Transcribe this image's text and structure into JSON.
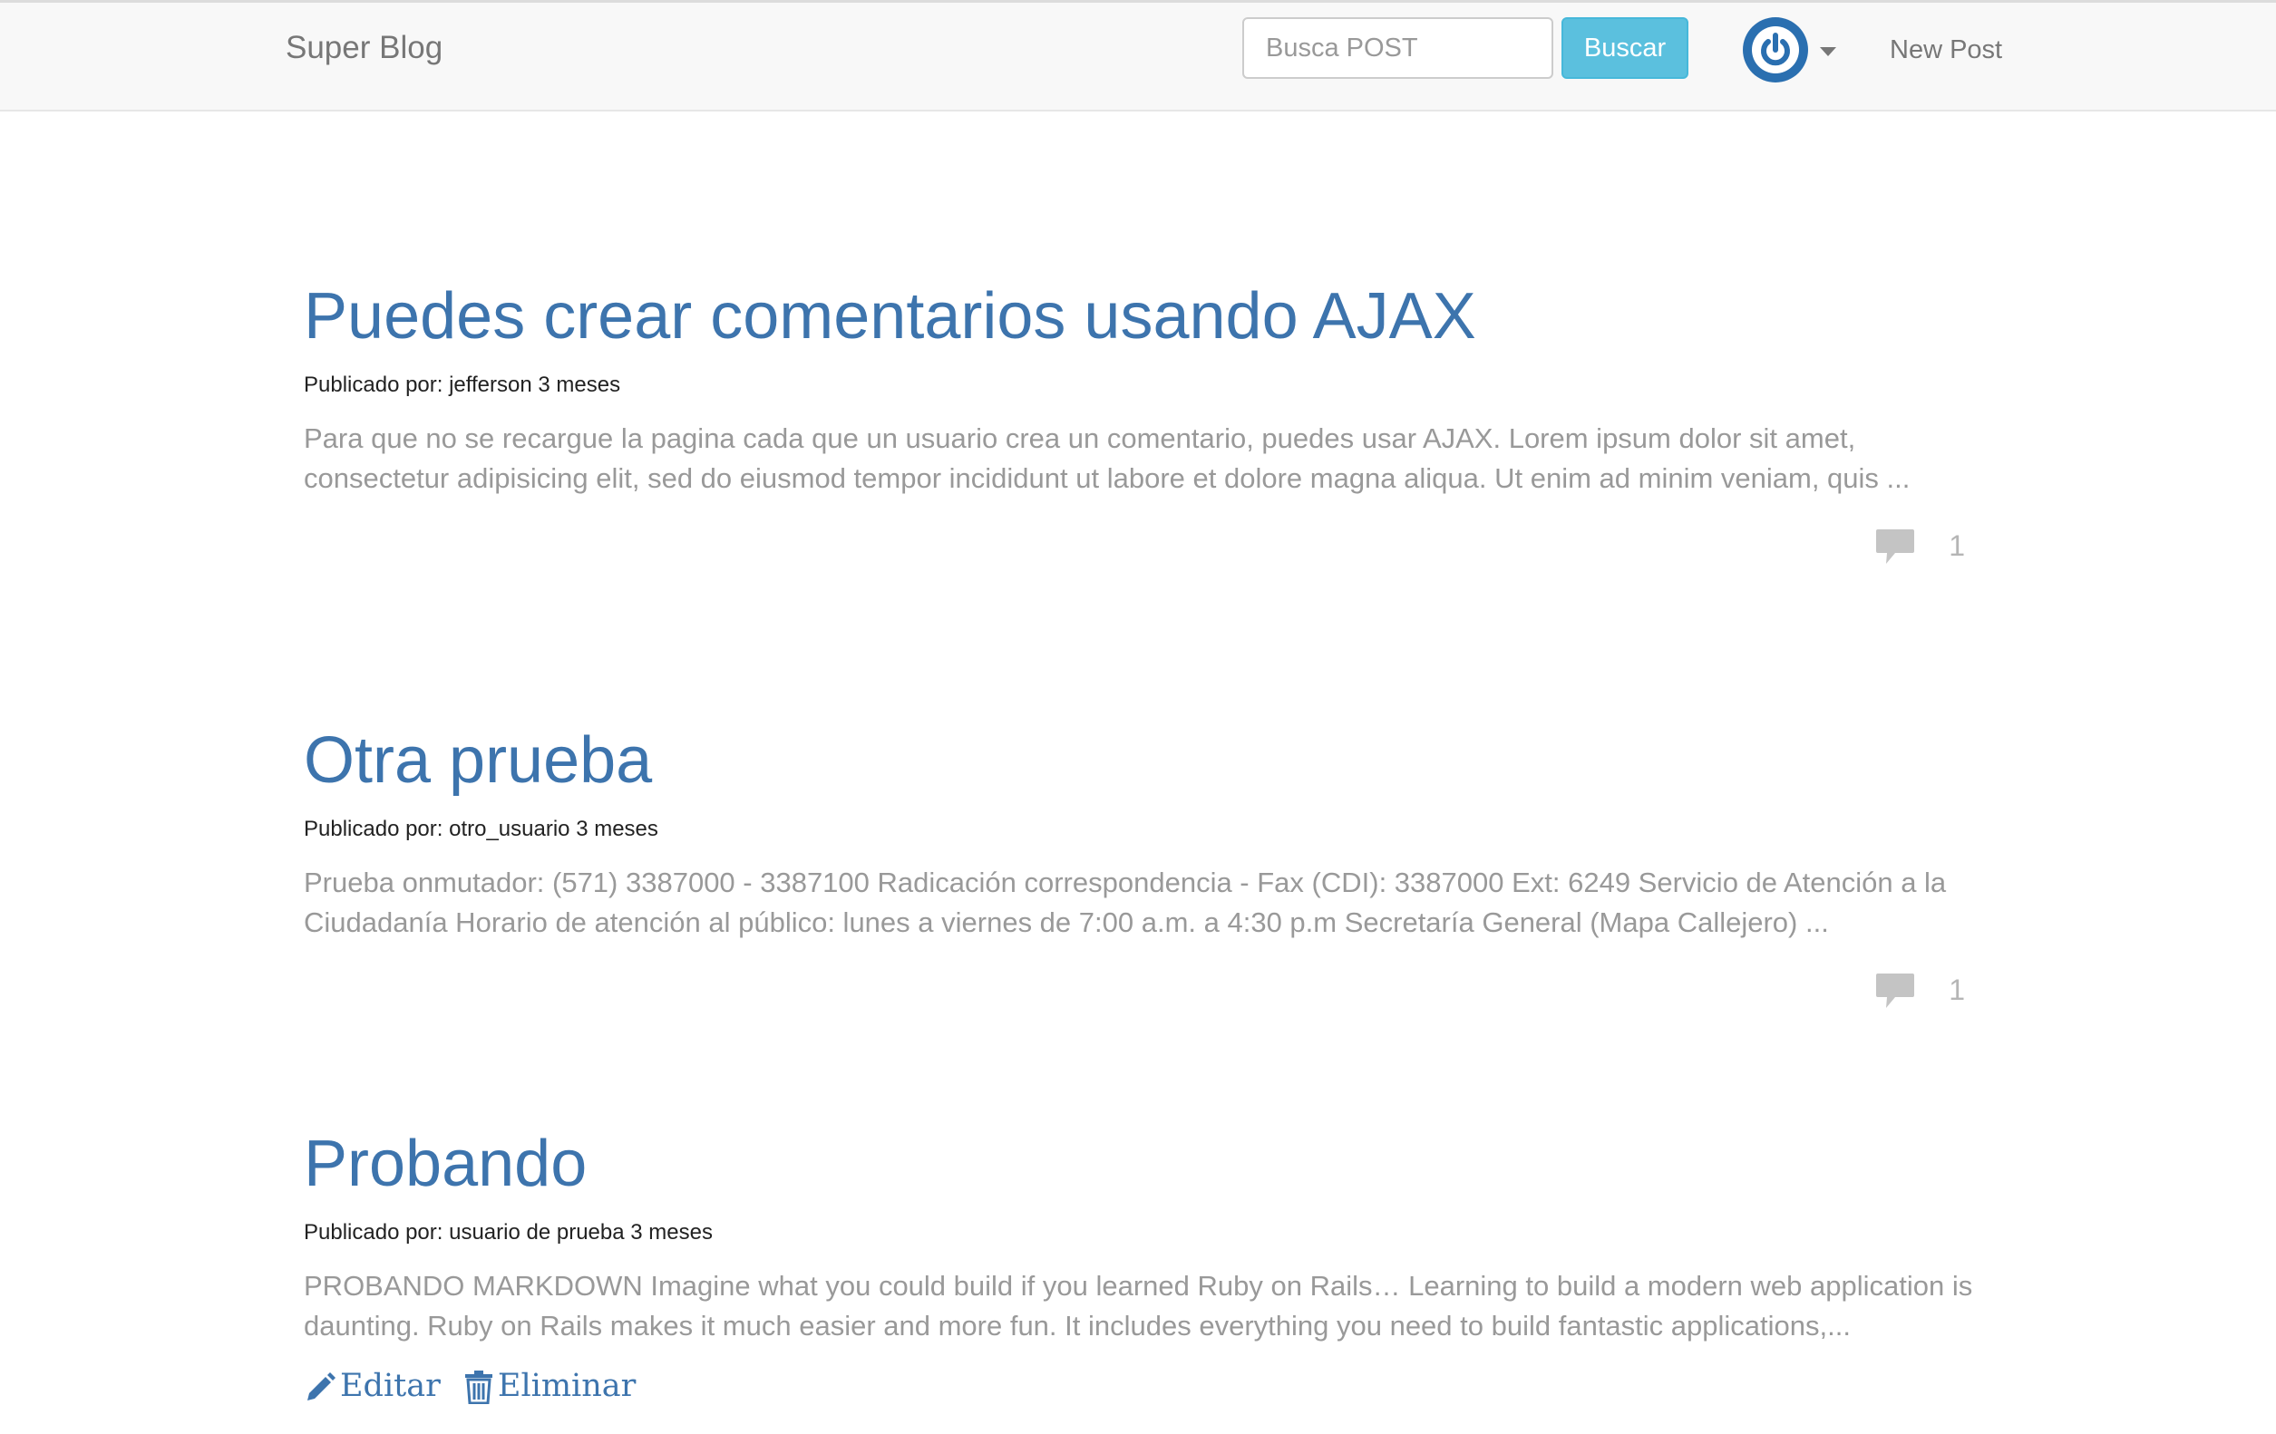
{
  "navbar": {
    "brand": "Super Blog",
    "search_placeholder": "Busca POST",
    "search_button": "Buscar",
    "new_post": "New Post"
  },
  "posts": [
    {
      "title": "Puedes crear comentarios usando AJAX",
      "meta": "Publicado por: jefferson 3 meses",
      "excerpt": "Para que no se recargue la pagina cada que un usuario crea un comentario, puedes usar AJAX. Lorem ipsum dolor sit amet, consectetur adipisicing elit, sed do eiusmod tempor incididunt ut labore et dolore magna aliqua. Ut enim ad minim veniam, quis ...",
      "comments": "1"
    },
    {
      "title": "Otra prueba",
      "meta": "Publicado por: otro_usuario 3 meses",
      "excerpt": "Prueba onmutador: (571) 3387000 - 3387100 Radicación correspondencia - Fax (CDI): 3387000 Ext: 6249 Servicio de Atención a la Ciudadanía Horario de atención al público: lunes a viernes de 7:00 a.m. a 4:30 p.m Secretaría General (Mapa Callejero) ...",
      "comments": "1"
    },
    {
      "title": "Probando",
      "meta": "Publicado por: usuario de prueba 3 meses",
      "excerpt": "PROBANDO MARKDOWN Imagine what you could build if you learned Ruby on Rails… Learning to build a modern web application is daunting. Ruby on Rails makes it much easier and more fun. It includes everything you need to build fantastic applications,...",
      "edit": "Editar",
      "delete": "Eliminar"
    }
  ],
  "colors": {
    "link": "#3d74ad",
    "button": "#5bc0de",
    "navbar_bg": "#f8f8f8",
    "muted_text": "#999999"
  },
  "icons": [
    "power-icon",
    "caret-down-icon",
    "comment-icon",
    "pencil-icon",
    "trash-icon"
  ]
}
